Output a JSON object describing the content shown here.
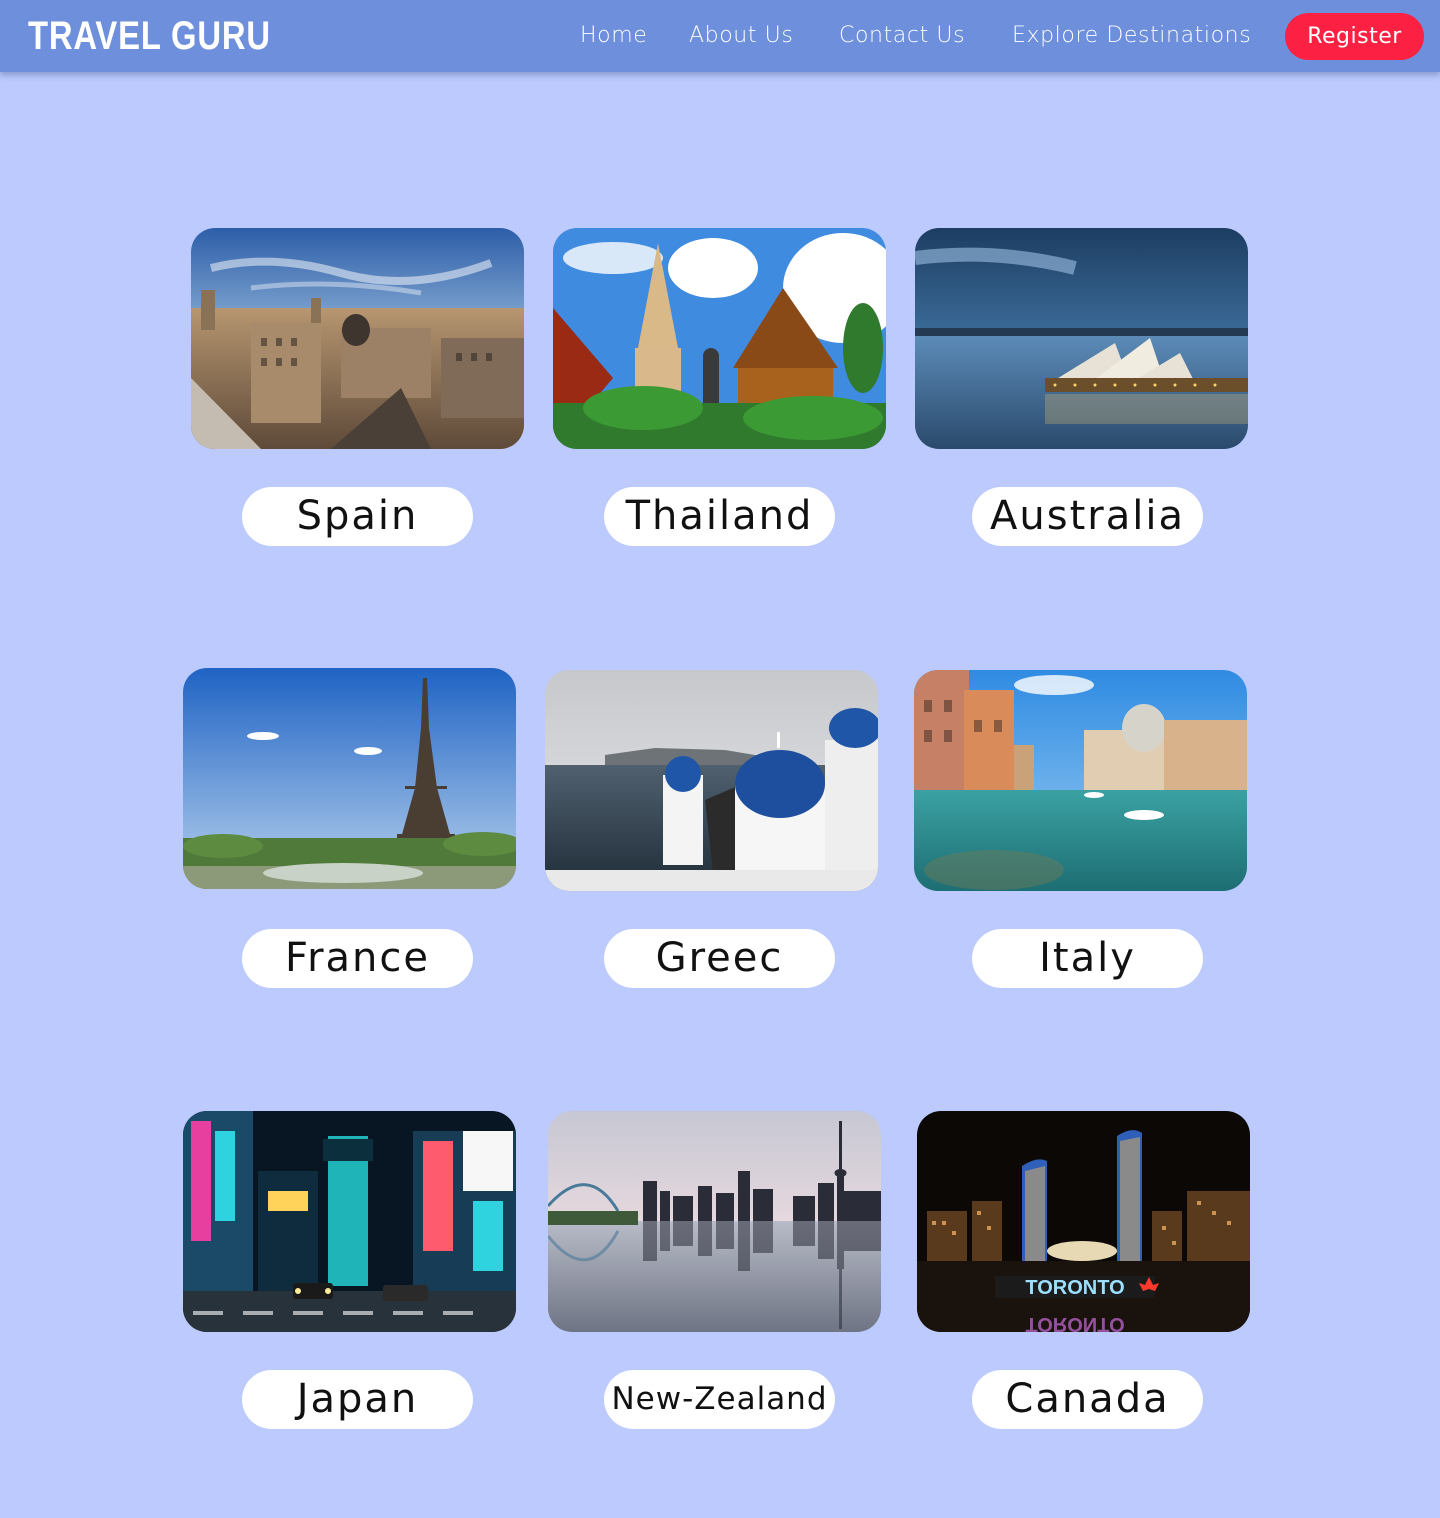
{
  "navbar": {
    "brand": "TRAVEL GURU",
    "links": [
      "Home",
      "About Us",
      "Contact Us",
      "Explore Destinations"
    ],
    "register_label": "Register"
  },
  "colors": {
    "page_background": "#bccafd",
    "navbar_background": "#6e8fdb",
    "register_button": "#fc2143",
    "label_background": "#ffffff"
  },
  "destinations": [
    {
      "name": "Spain",
      "image": "madrid-cityscape-photo"
    },
    {
      "name": "Thailand",
      "image": "thai-temples-photo"
    },
    {
      "name": "Australia",
      "image": "sydney-opera-house-photo"
    },
    {
      "name": "France",
      "image": "eiffel-tower-photo"
    },
    {
      "name": "Greec",
      "image": "santorini-blue-domes-photo"
    },
    {
      "name": "Italy",
      "image": "venice-grand-canal-photo"
    },
    {
      "name": "Japan",
      "image": "tokyo-shibuya-night-photo"
    },
    {
      "name": "New-Zealand",
      "image": "auckland-skyline-photo"
    },
    {
      "name": "Canada",
      "image": "toronto-city-hall-photo"
    }
  ]
}
